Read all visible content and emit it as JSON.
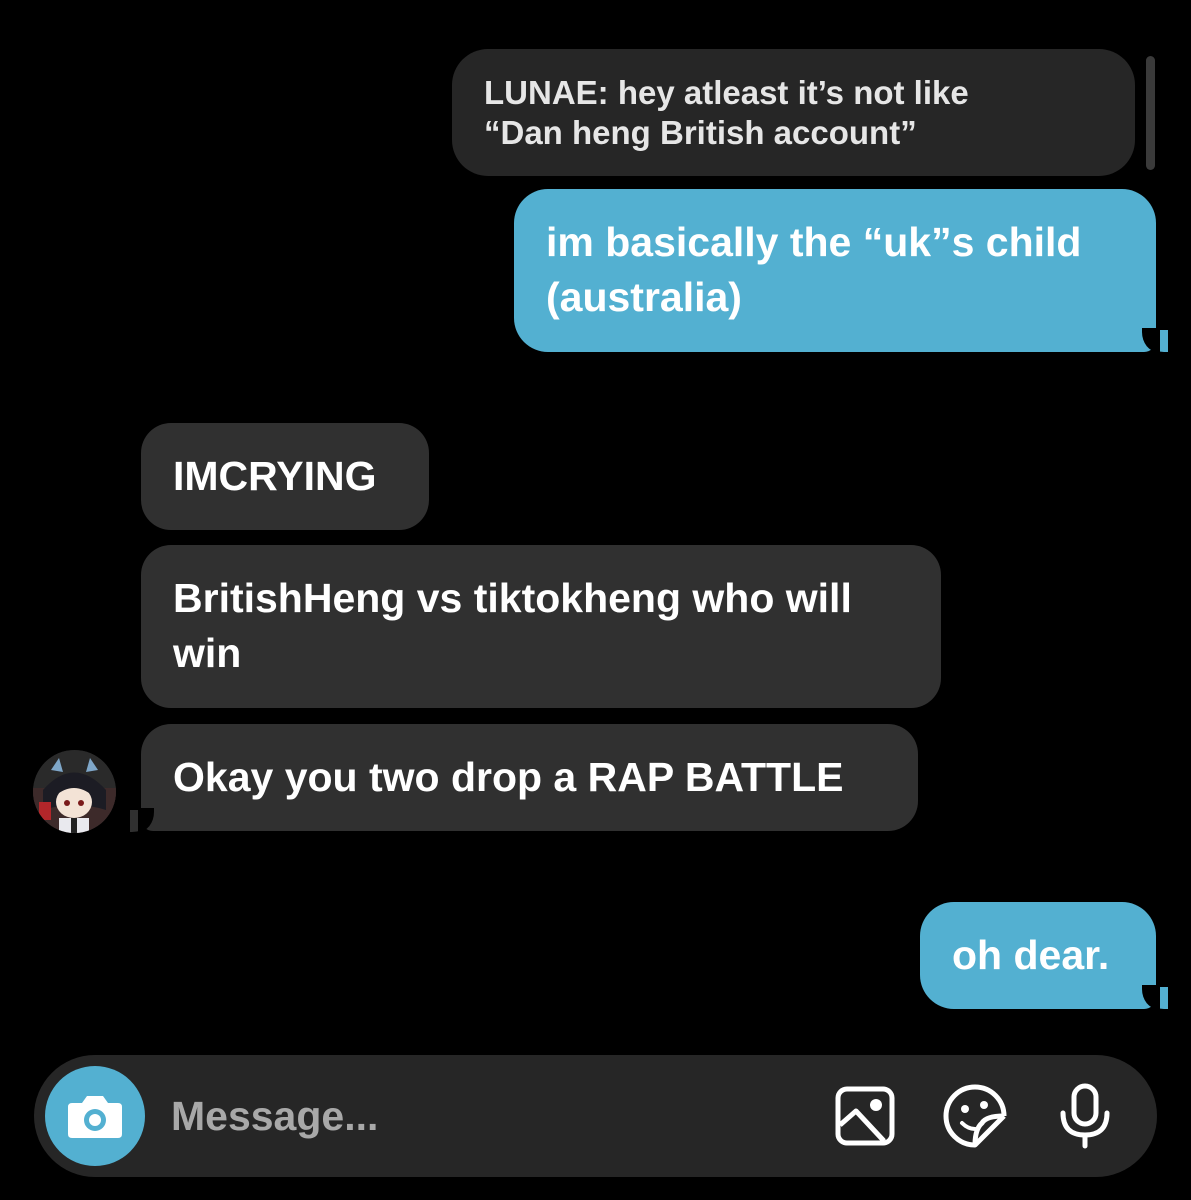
{
  "reply": {
    "text_line1": "LUNAE: hey atleast it’s not like",
    "text_line2": "“Dan heng British account”"
  },
  "messages": {
    "out_1": "im basically the “uk”s child (australia)",
    "in_1": "IMCRYING",
    "in_2": "BritishHeng vs tiktokheng who will win",
    "in_3": "Okay you two drop a RAP BATTLE",
    "out_2": "oh dear."
  },
  "composer": {
    "placeholder": "Message...",
    "icons": [
      "camera-icon",
      "gallery-icon",
      "sticker-icon",
      "microphone-icon"
    ]
  },
  "colors": {
    "background": "#000000",
    "outgoing_bubble": "#53b0d1",
    "incoming_bubble": "#303030",
    "reply_bubble": "#262626",
    "composer": "#262626",
    "placeholder": "#a8a8a8"
  }
}
